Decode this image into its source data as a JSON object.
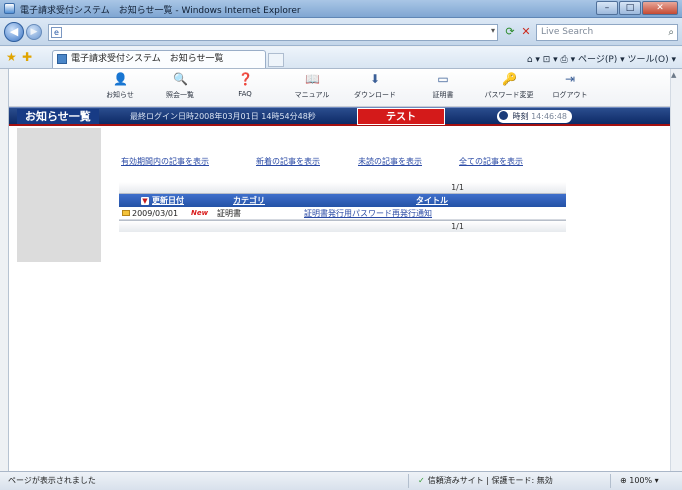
{
  "window": {
    "title": "電子請求受付システム　お知らせ一覧 - Windows Internet Explorer",
    "controls": [
      "–",
      "□",
      "✕"
    ]
  },
  "address_bar": {
    "url": "",
    "search_placeholder": "Live Search"
  },
  "command_bar": {
    "tab_label": "電子請求受付システム　お知らせ一覧",
    "right_tools": "⌂ ▾ ⊡ ▾ ⎙ ▾ ページ(P) ▾ ツール(O) ▾"
  },
  "app_toolbar": {
    "items": [
      {
        "label": "お知らせ",
        "icon": "person-icon",
        "glyph": "👤"
      },
      {
        "label": "照会一覧",
        "icon": "search-icon",
        "glyph": "🔍"
      },
      {
        "label": "FAQ",
        "icon": "faq-icon",
        "glyph": "❓"
      },
      {
        "label": "マニュアル",
        "icon": "manual-icon",
        "glyph": "📖"
      },
      {
        "label": "ダウンロード",
        "icon": "download-icon",
        "glyph": "⬇"
      },
      {
        "label": "証明書",
        "icon": "certificate-icon",
        "glyph": "▭"
      },
      {
        "label": "パスワード変更",
        "icon": "key-icon",
        "glyph": "🔑"
      },
      {
        "label": "ログアウト",
        "icon": "logout-icon",
        "glyph": "⇥"
      }
    ]
  },
  "header": {
    "page_title": "お知らせ一覧",
    "last_login": "最終ログイン日時2008年03月01日 14時54分48秒",
    "test_badge": "テスト",
    "clock_label": "時刻",
    "clock_time": "14:46:48"
  },
  "filters": {
    "valid_period": "有効期間内の記事を表示",
    "new_articles": "新着の記事を表示",
    "unread": "未読の記事を表示",
    "all": "全ての記事を表示"
  },
  "table": {
    "pager": "1/1",
    "columns": {
      "updated": "更新日付",
      "category": "カテゴリ",
      "title": "タイトル"
    },
    "rows": [
      {
        "date": "2009/03/01",
        "new_badge": "New",
        "category": "証明書",
        "title": "証明書発行用パスワード再発行通知"
      }
    ]
  },
  "status_bar": {
    "text": "ページが表示されました",
    "zone": "信頼済みサイト | 保護モード: 無効",
    "zoom": "100%"
  }
}
